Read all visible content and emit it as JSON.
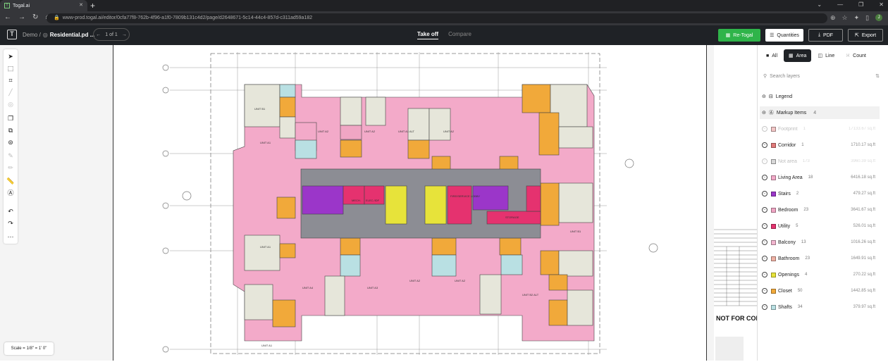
{
  "browser": {
    "tab_title": "Togal.ai",
    "url": "www-prod.togal.ai/editor/0cfa77f8-762b-4f96-a1f0-7809b131c4d2/page/d2648671-5c14-44c4-857d-c311ad59a182"
  },
  "header": {
    "breadcrumb_root": "Demo /",
    "file_name": "Residential.pd ...",
    "page_indicator": "1 of 1",
    "tabs": [
      "Take off",
      "Compare"
    ],
    "buttons": {
      "retogal": "Re-Togal",
      "quantities": "Quantities",
      "pdf": "PDF",
      "export": "Export"
    }
  },
  "colors": {
    "accent_green": "#2fb44a",
    "topbar": "#1f2226"
  },
  "canvas": {
    "scale_label": "Scale = 1/8\" = 1' 0\"",
    "sheet_stamp": "NOT FOR CONSTRUCT",
    "unit_labels": [
      "UNIT A2",
      "UNIT A2",
      "UNIT A1 ALT",
      "UNIT A2",
      "UNIT B1",
      "UNIT A1",
      "UNIT A4",
      "UNIT A3",
      "UNIT A1",
      "UNIT A2",
      "UNIT A2",
      "UNIT B2 ALT",
      "UNIT B1",
      "UNIT A1"
    ],
    "room_labels": [
      "MECH.",
      "ELEC./IDF",
      "FIRE/SERVICE LOBBY",
      "STORAGE"
    ]
  },
  "panel": {
    "filter_tabs": [
      "All",
      "Area",
      "Line",
      "Count"
    ],
    "search_placeholder": "Search layers",
    "legend_label": "Legend",
    "markup_label": "Markup Items",
    "markup_count": "4",
    "layers": [
      {
        "name": "Footprint",
        "count": "1",
        "area": "17133.67 sq.ft",
        "color": "#f3c6c6",
        "faded": true
      },
      {
        "name": "Corridor",
        "count": "1",
        "area": "1710.17 sq.ft",
        "color": "#e07a7a",
        "faded": false
      },
      {
        "name": "Not area",
        "count": "173",
        "area": "3960.39 sq.ft",
        "color": "#d8d8d8",
        "faded": true
      },
      {
        "name": "Living Area",
        "count": "18",
        "area": "6416.18 sq.ft",
        "color": "#f3aac9",
        "faded": false
      },
      {
        "name": "Stairs",
        "count": "2",
        "area": "479.27 sq.ft",
        "color": "#9b36c9",
        "faded": false
      },
      {
        "name": "Bedroom",
        "count": "23",
        "area": "3641.67 sq.ft",
        "color": "#f0a6c4",
        "faded": false
      },
      {
        "name": "Utility",
        "count": "5",
        "area": "526.01 sq.ft",
        "color": "#e5326f",
        "faded": false
      },
      {
        "name": "Balcony",
        "count": "13",
        "area": "1016.26 sq.ft",
        "color": "#f2b6cf",
        "faded": false
      },
      {
        "name": "Bathroom",
        "count": "23",
        "area": "1649.91 sq.ft",
        "color": "#f0b1a4",
        "faded": false
      },
      {
        "name": "Openings",
        "count": "4",
        "area": "270.22 sq.ft",
        "color": "#e7e33a",
        "faded": false
      },
      {
        "name": "Closet",
        "count": "50",
        "area": "1442.85 sq.ft",
        "color": "#f1a93a",
        "faded": false
      },
      {
        "name": "Shafts",
        "count": "34",
        "area": "379.97 sq.ft",
        "color": "#b9e0e3",
        "faded": false
      }
    ]
  }
}
